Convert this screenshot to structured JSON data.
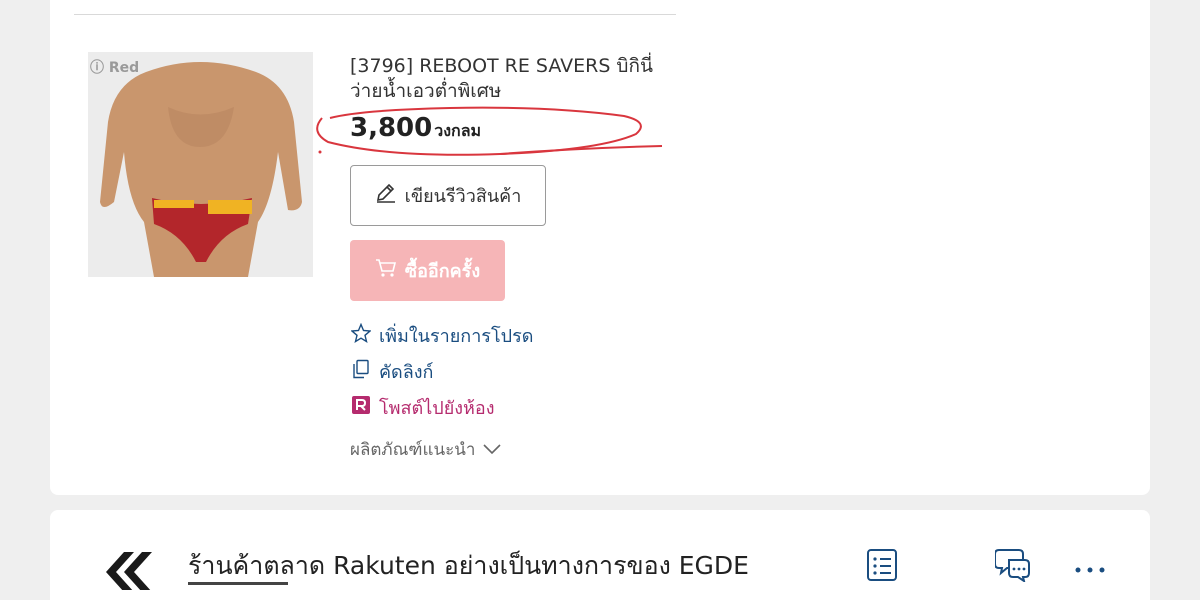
{
  "product": {
    "image_badge": "Red",
    "title": "[3796] REBOOT RE SAVERS บิกินี่ว่ายน้ำเอวต่ำพิเศษ",
    "price": "3,800",
    "price_unit": "วงกลม"
  },
  "actions": {
    "review_label": "เขียนรีวิวสินค้า",
    "buy_again_label": "ซื้ออีกครั้ง",
    "favorite_label": "เพิ่มในรายการโปรด",
    "copy_link_label": "คัดลิงก์",
    "post_room_label": "โพสต์ไปยังห้อง",
    "recommended_label": "ผลิตภัณฑ์แนะนำ"
  },
  "shop": {
    "name": "ร้านค้าตลาด Rakuten อย่างเป็นทางการของ EGDE"
  },
  "colors": {
    "buy_button": "#f6b5b7",
    "link_blue": "#1a4d80",
    "rakuten_magenta": "#b52b6e",
    "annotation_red": "#d9363e"
  },
  "icons": {
    "review": "pencil-icon",
    "buy": "cart-icon",
    "favorite": "star-icon",
    "copy": "copy-icon",
    "post": "rakuten-room-icon",
    "recommend": "chevron-down-icon",
    "shop_back": "double-chevron-left-icon",
    "list": "list-icon",
    "chat": "chat-icon",
    "more": "more-icon"
  }
}
